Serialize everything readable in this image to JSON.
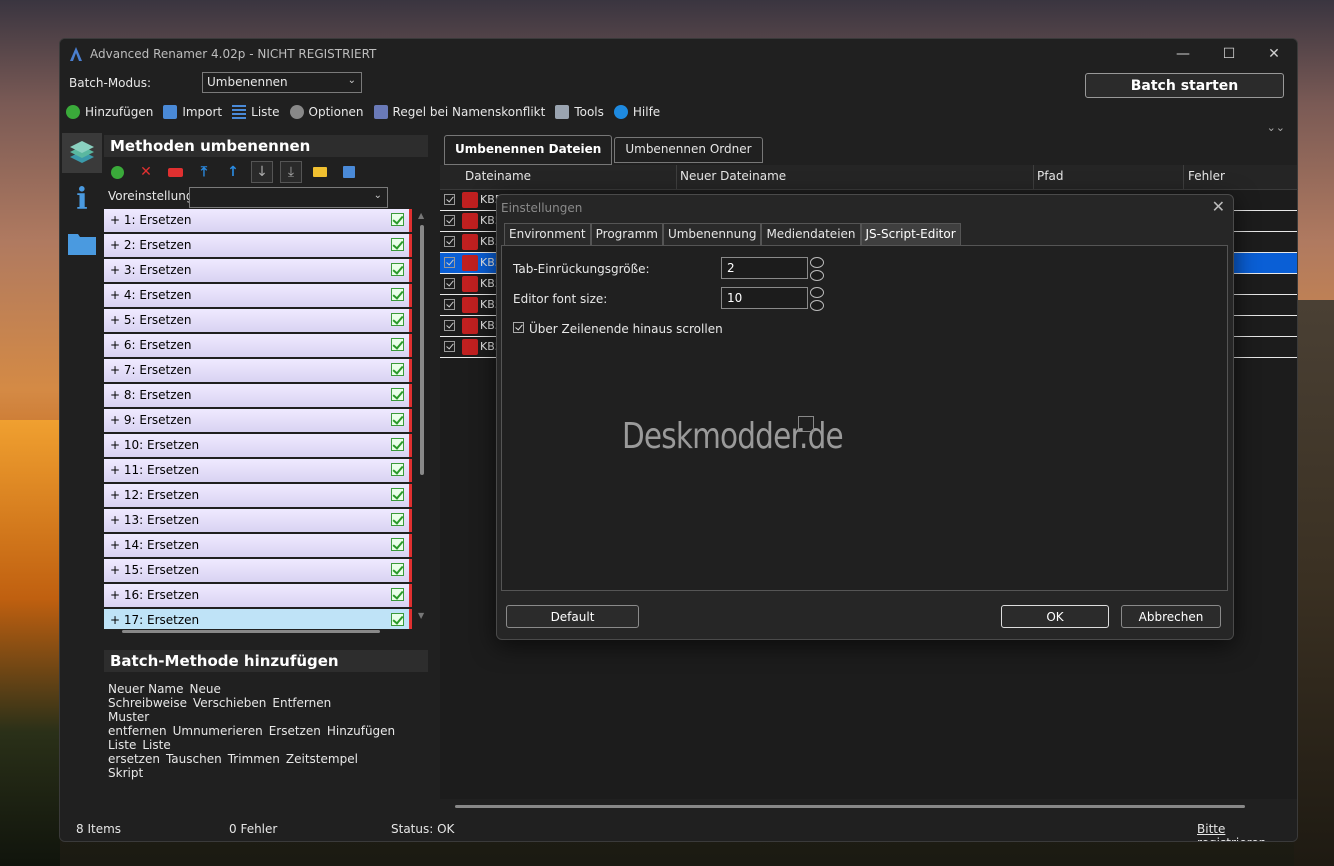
{
  "window": {
    "title": "Advanced Renamer 4.02p - NICHT REGISTRIERT",
    "batch_mode_label": "Batch-Modus:",
    "batch_mode_value": "Umbenennen",
    "batch_start": "Batch starten"
  },
  "toolbar": [
    {
      "label": "Hinzufügen",
      "icon": "add-icon"
    },
    {
      "label": "Import",
      "icon": "import-icon"
    },
    {
      "label": "Liste",
      "icon": "list-icon"
    },
    {
      "label": "Optionen",
      "icon": "gear-icon"
    },
    {
      "label": "Regel bei Namenskonflikt",
      "icon": "conflict-icon"
    },
    {
      "label": "Tools",
      "icon": "wrench-icon"
    },
    {
      "label": "Hilfe",
      "icon": "help-icon"
    }
  ],
  "methods": {
    "header": "Methoden umbenennen",
    "preset_label": "Voreinstellunge",
    "items": [
      "+  1: Ersetzen",
      "+  2: Ersetzen",
      "+  3: Ersetzen",
      "+  4: Ersetzen",
      "+  5: Ersetzen",
      "+  6: Ersetzen",
      "+  7: Ersetzen",
      "+  8: Ersetzen",
      "+  9: Ersetzen",
      "+  10: Ersetzen",
      "+  11: Ersetzen",
      "+  12: Ersetzen",
      "+  13: Ersetzen",
      "+  14: Ersetzen",
      "+  15: Ersetzen",
      "+  16: Ersetzen",
      "+  17: Ersetzen"
    ]
  },
  "batch_methods": {
    "header": "Batch-Methode hinzufügen",
    "rows": [
      [
        "Neuer Name",
        "Neue Schreibweise",
        "Verschieben",
        "Entfernen"
      ],
      [
        "Muster entfernen",
        "Umnumerieren",
        "Ersetzen",
        "Hinzufügen"
      ],
      [
        "Liste",
        "Liste ersetzen",
        "Tauschen",
        "Trimmen",
        "Zeitstempel"
      ],
      [
        "Skript"
      ]
    ]
  },
  "file_tabs": [
    "Umbenennen Dateien",
    "Umbenennen Ordner"
  ],
  "grid": {
    "columns": [
      "Dateiname",
      "Neuer Dateiname",
      "Pfad",
      "Fehler"
    ],
    "rows": [
      "KB5",
      "KB5",
      "KB5",
      "KB5",
      "KB5",
      "KB5",
      "KB5",
      "KB5"
    ]
  },
  "status": {
    "items": "8 Items",
    "errors": "0 Fehler",
    "status": "Status: OK",
    "register": "Bitte registrieren"
  },
  "dialog": {
    "title": "Einstellungen",
    "tabs": [
      "Environment",
      "Programm",
      "Umbenennung",
      "Mediendateien",
      "JS-Script-Editor"
    ],
    "tab_indent_label": "Tab-Einrückungsgröße:",
    "tab_indent_value": "2",
    "font_size_label": "Editor font size:",
    "font_size_value": "10",
    "scroll_label": "Über Zeilenende hinaus scrollen",
    "watermark": "Deskmodder.de",
    "default_btn": "Default",
    "ok_btn": "OK",
    "cancel_btn": "Abbrechen"
  },
  "colors": {
    "accent": "#0a5fd6",
    "method_bg": "#e4def8"
  }
}
